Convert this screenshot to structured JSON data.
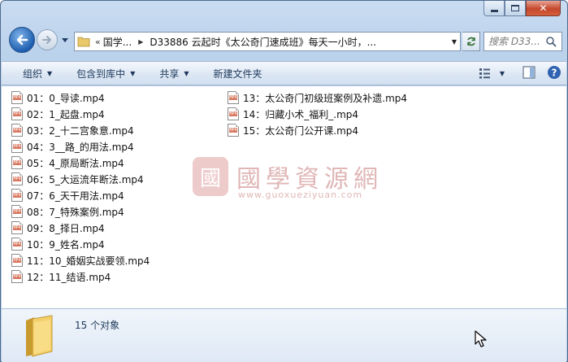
{
  "window": {
    "caption_buttons": [
      "minimize",
      "maximize",
      "close"
    ]
  },
  "nav": {
    "address_segments": [
      "国学...",
      "D33886 云起时《太公奇门速成班》每天一小时，..."
    ],
    "overflow_chevron": "«",
    "search_placeholder": "搜索 D33..."
  },
  "toolbar": {
    "organize": "组织",
    "include_in_library": "包含到库中",
    "share": "共享",
    "new_folder": "新建文件夹"
  },
  "files": {
    "column1": [
      "01：0_导读.mp4",
      "02：1_起盘.mp4",
      "03：2_十二宫象意.mp4",
      "04：3__路_的用法.mp4",
      "05：4_原局断法.mp4",
      "06：5_大运流年断法.mp4",
      "07：6_天干用法.mp4",
      "08：7_特殊案例.mp4",
      "09：8_择日.mp4",
      "10：9_姓名.mp4",
      "11：10_婚姻实战要领.mp4",
      "12：11_结语.mp4"
    ],
    "column2": [
      "13：太公奇门初级班案例及补遗.mp4",
      "14：归藏小术_福利_.mp4",
      "15：太公奇门公开课.mp4"
    ],
    "file_icon_label": "MP4"
  },
  "watermark": {
    "seal": "國",
    "title": "國學資源網",
    "url": "www.guoxueziyuan.com"
  },
  "details": {
    "item_count": "15 个对象"
  },
  "colors": {
    "accent": "#1e395b",
    "file_icon_band": "#d7775f",
    "watermark": "#c77b7b"
  }
}
